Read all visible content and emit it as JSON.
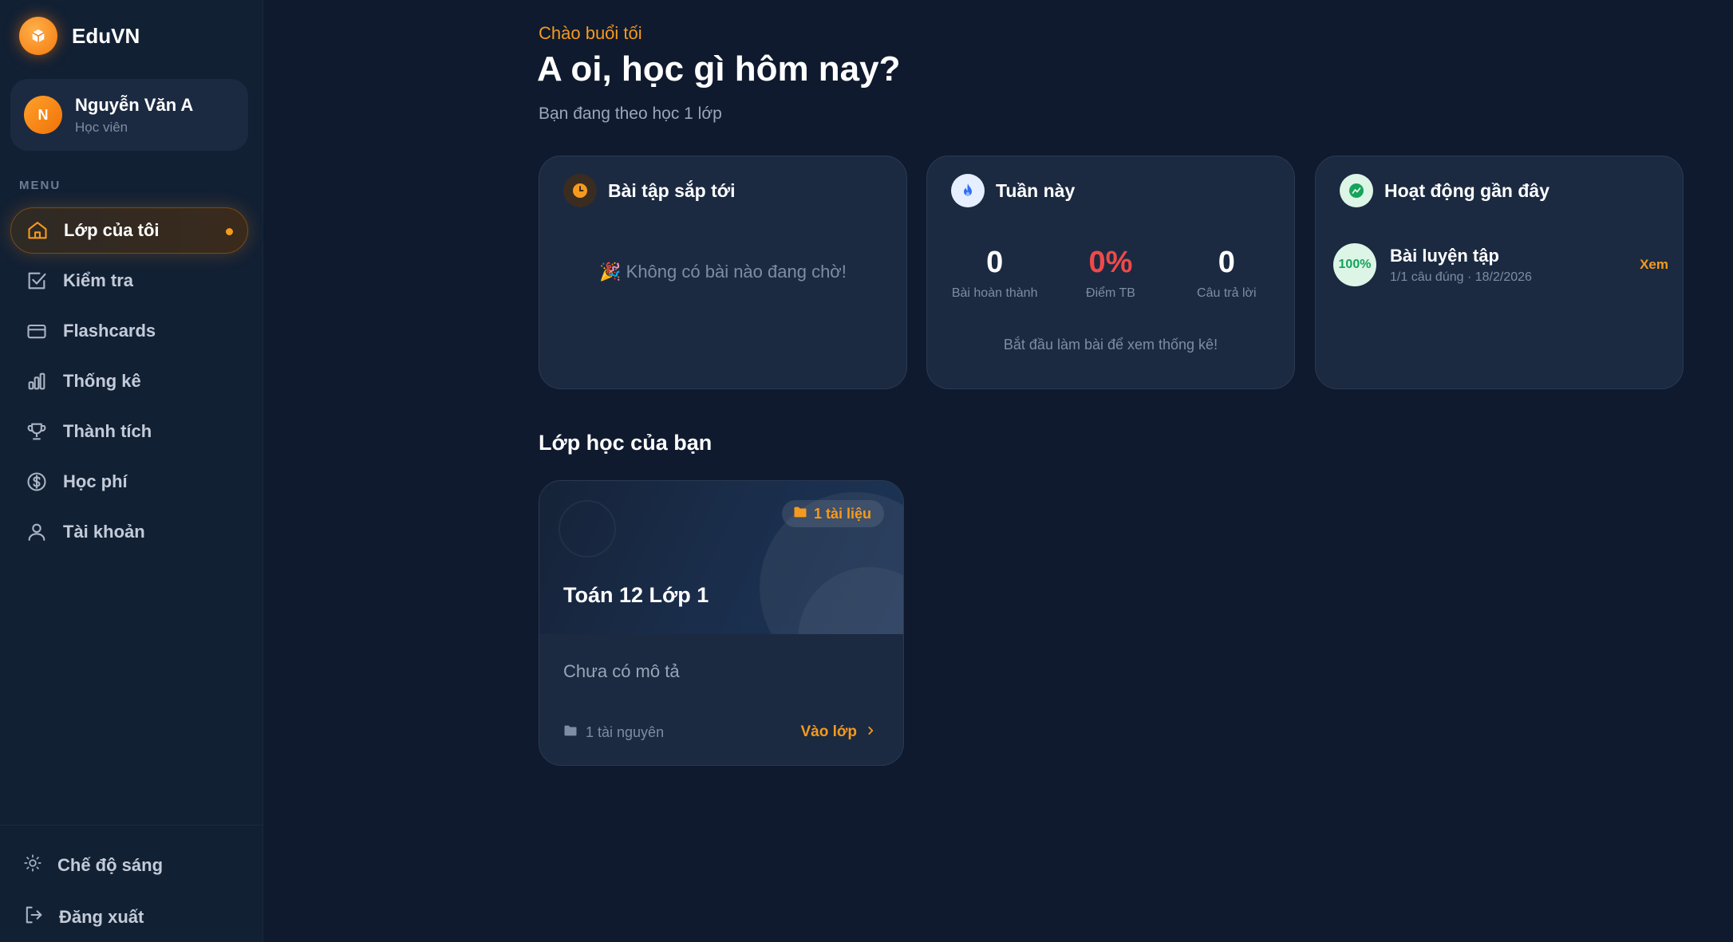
{
  "brand": {
    "name": "EduVN",
    "logo_icon": "cube-icon"
  },
  "user": {
    "initial": "N",
    "name": "Nguyễn Văn A",
    "role": "Học viên"
  },
  "sidebar": {
    "menu_label": "MENU",
    "items": [
      {
        "label": "Lớp của tôi",
        "icon": "home-icon",
        "active": true
      },
      {
        "label": "Kiểm tra",
        "icon": "checkbox-icon"
      },
      {
        "label": "Flashcards",
        "icon": "card-icon"
      },
      {
        "label": "Thống kê",
        "icon": "bar-chart-icon"
      },
      {
        "label": "Thành tích",
        "icon": "trophy-icon"
      },
      {
        "label": "Học phí",
        "icon": "dollar-icon"
      },
      {
        "label": "Tài khoản",
        "icon": "user-icon"
      }
    ],
    "bottom": {
      "theme_label": "Chế độ sáng",
      "logout_label": "Đăng xuất"
    }
  },
  "header": {
    "greeting": "Chào buổi tối",
    "title": "A oi, học gì hôm nay?",
    "subtitle": "Bạn đang theo học 1 lớp"
  },
  "cards": {
    "upcoming": {
      "title": "Bài tập sắp tới",
      "empty_text": "🎉 Không có bài nào đang chờ!"
    },
    "week": {
      "title": "Tuần này",
      "stats": [
        {
          "value": "0",
          "label": "Bài hoàn thành"
        },
        {
          "value": "0%",
          "label": "Điểm TB"
        },
        {
          "value": "0",
          "label": "Câu trả lời"
        }
      ],
      "hint": "Bắt đầu làm bài để xem thống kê!"
    },
    "activity": {
      "title": "Hoạt động gần đây",
      "items": [
        {
          "badge": "100%",
          "title": "Bài luyện tập",
          "subtitle": "1/1 câu đúng · 18/2/2026",
          "action": "Xem"
        }
      ]
    }
  },
  "classes": {
    "section_title": "Lớp học của bạn",
    "items": [
      {
        "name": "Toán 12 Lớp 1",
        "doc_badge": "1 tài liệu",
        "description": "Chưa có mô tả",
        "resources": "1 tài nguyên",
        "enter_label": "Vào lớp"
      }
    ]
  },
  "colors": {
    "accent": "#f59a1e",
    "background": "#0f1a2e",
    "sidebar": "#122034",
    "card": "#1b2a41",
    "danger": "#f0494a",
    "success": "#10a45a"
  }
}
